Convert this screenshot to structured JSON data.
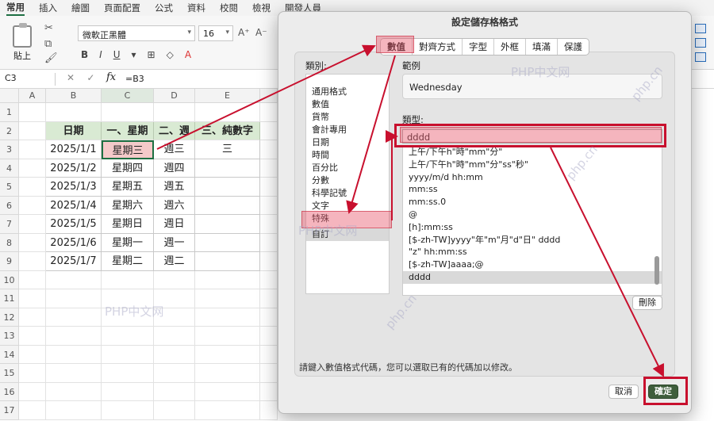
{
  "ribbon": {
    "tabs": [
      "常用",
      "插入",
      "繪圖",
      "頁面配置",
      "公式",
      "資料",
      "校閱",
      "檢視",
      "開發人員"
    ],
    "paste_label": "貼上",
    "font_name": "微軟正黑體",
    "font_size": "16",
    "bold": "B",
    "italic": "I",
    "underline": "U"
  },
  "formula_bar": {
    "name_box": "C3",
    "fx": "fx",
    "formula": "=B3"
  },
  "sheet": {
    "columns": [
      "A",
      "B",
      "C",
      "D",
      "E"
    ],
    "rows": [
      "1",
      "2",
      "3",
      "4",
      "5",
      "6",
      "7",
      "8",
      "9",
      "10",
      "11",
      "12",
      "13",
      "14",
      "15",
      "16",
      "17"
    ],
    "headers": [
      "日期",
      "一、星期",
      "二、週",
      "三、純數字"
    ],
    "data": [
      [
        "2025/1/1",
        "星期三",
        "週三",
        "三"
      ],
      [
        "2025/1/2",
        "星期四",
        "週四",
        ""
      ],
      [
        "2025/1/3",
        "星期五",
        "週五",
        ""
      ],
      [
        "2025/1/4",
        "星期六",
        "週六",
        ""
      ],
      [
        "2025/1/5",
        "星期日",
        "週日",
        ""
      ],
      [
        "2025/1/6",
        "星期一",
        "週一",
        ""
      ],
      [
        "2025/1/7",
        "星期二",
        "週二",
        ""
      ]
    ]
  },
  "dialog": {
    "title": "設定儲存格格式",
    "tabs": [
      "數值",
      "對齊方式",
      "字型",
      "外框",
      "填滿",
      "保護"
    ],
    "category_label": "類別:",
    "categories": [
      "通用格式",
      "數值",
      "貨幣",
      "會計專用",
      "日期",
      "時間",
      "百分比",
      "分數",
      "科學記號",
      "文字",
      "特殊",
      "自訂"
    ],
    "sample_label": "範例",
    "sample_value": "Wednesday",
    "type_label": "類型:",
    "type_value": "dddd",
    "codes": [
      "上午/下午h\"時\"mm\"分\"",
      "上午/下午h\"時\"mm\"分\"ss\"秒\"",
      "yyyy/m/d hh:mm",
      "mm:ss",
      "mm:ss.0",
      "@",
      "[h]:mm:ss",
      "[$-zh-TW]yyyy\"年\"m\"月\"d\"日\" dddd",
      "\"z\" hh:mm:ss",
      "[$-zh-TW]aaaa;@",
      "dddd"
    ],
    "delete_label": "刪除",
    "hint": "請鍵入數值格式代碼，您可以選取已有的代碼加以修改。",
    "cancel_label": "取消",
    "ok_label": "確定"
  },
  "watermarks": [
    "PHP中文网",
    "PHP中文网",
    "PHP中文网",
    "php.cn",
    "php.cn",
    "php.cn"
  ],
  "colors": {
    "accent_green": "#1d6f42",
    "header_fill": "#d9ead3",
    "annotation_red": "#c8102e",
    "ok_button": "#3f5e3c"
  }
}
